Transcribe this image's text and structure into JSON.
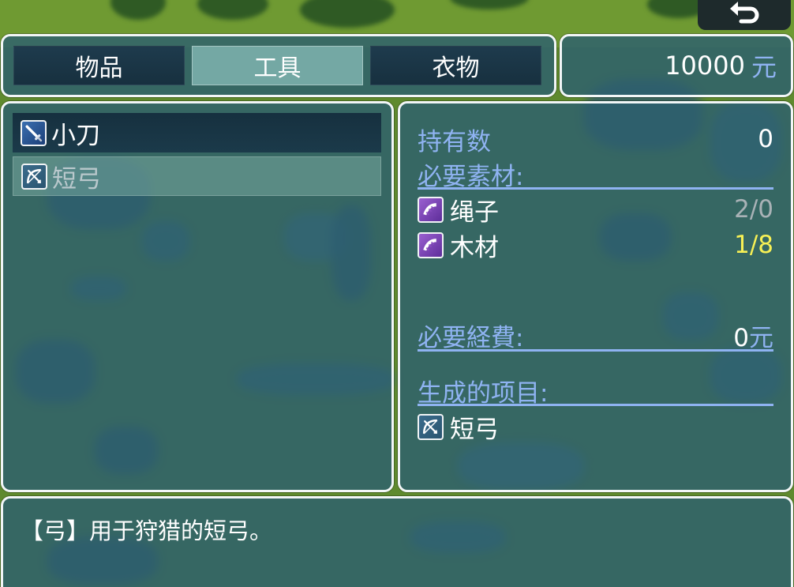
{
  "tabs": [
    {
      "label": "物品"
    },
    {
      "label": "工具"
    },
    {
      "label": "衣物"
    }
  ],
  "active_tab": 1,
  "gold": {
    "amount": "10000",
    "unit": "元"
  },
  "items": [
    {
      "name": "小刀",
      "icon": "knife-icon",
      "enabled": true
    },
    {
      "name": "短弓",
      "icon": "bow-icon",
      "enabled": false
    }
  ],
  "detail": {
    "owned_label": "持有数",
    "owned_value": "0",
    "materials_label": "必要素材:",
    "materials": [
      {
        "name": "绳子",
        "icon": "rope-icon",
        "count": "2/0",
        "status": "enough"
      },
      {
        "name": "木材",
        "icon": "wood-icon",
        "count": "1/8",
        "status": "short"
      }
    ],
    "cost_label": "必要経費:",
    "cost_value": "0",
    "cost_unit": "元",
    "result_label": "生成的项目:",
    "result_item": {
      "name": "短弓",
      "icon": "bow-icon"
    }
  },
  "help_text": "【弓】用于狩猎的短弓。",
  "colors": {
    "system_blue": "#8fb3f2",
    "shortage_yellow": "#f7f055",
    "window_border": "#f2f6f7"
  }
}
